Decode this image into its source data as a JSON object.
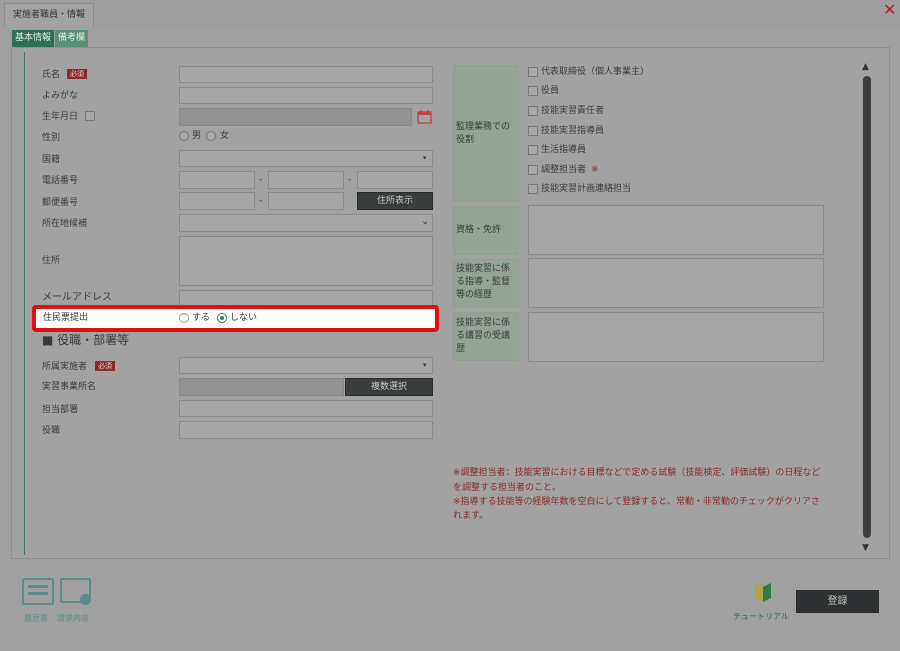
{
  "window": {
    "title": "実施者職員・情報",
    "close_glyph": "✕"
  },
  "tabs": [
    "基本情報",
    "備考欄"
  ],
  "form": {
    "name": {
      "label": "氏名",
      "required_badge": "必須"
    },
    "furigana": {
      "label": "よみがな"
    },
    "birthdate": {
      "label": "生年月日"
    },
    "gender": {
      "label": "性別",
      "options": [
        "男",
        "女"
      ]
    },
    "nationality": {
      "label": "国籍"
    },
    "phone": {
      "label": "電話番号",
      "sep1": "-",
      "sep2": "-"
    },
    "postal": {
      "label": "郵便番号",
      "sep": "-",
      "button": "住所表示"
    },
    "prefecture": {
      "label": "所在地候補"
    },
    "address": {
      "label": "住所"
    },
    "email": {
      "label": "メールアドレス"
    },
    "resident": {
      "label": "住民票提出",
      "options": [
        "する",
        "しない"
      ],
      "selected": "しない"
    },
    "section_heading": "■ 役職・部署等",
    "company": {
      "label": "所属実施者",
      "required_badge": "必須"
    },
    "site": {
      "label": "実習事業所名",
      "button": "複数選択"
    },
    "department": {
      "label": "担当部署"
    },
    "position": {
      "label": "役職"
    }
  },
  "right": {
    "roles_label": "監理業務での役割",
    "roles": [
      "代表取締役（個人事業主）",
      "役員",
      "技能実習責任者",
      "技能実習指導員",
      "生活指導員",
      "調整担当者",
      "技能実習計画連絡担当"
    ],
    "coordinator_mark": "※",
    "qualification_label": "資格・免許",
    "guidance_label": "技能実習に係る指導・監督等の経歴",
    "training_label": "技能実習に係る講習の受講歴"
  },
  "notes": [
    "※調整担当者：技能実習における目標などで定める試験（技能検定、評価試験）の日程など",
    "を調整する担当者のこと。",
    "※指導する技能等の経験年数を空白にして登録すると、常勤・非常勤のチェックがクリアさ",
    "れます。"
  ],
  "footer": {
    "resume_label": "履歴書",
    "request_label": "請求内容",
    "tutorial_label": "チュートリアル",
    "register_button": "登録"
  },
  "icons": [
    "calendar-icon",
    "chevron-down-icon",
    "scroll-up-icon",
    "scroll-down-icon",
    "beginner-leaf-icon"
  ],
  "colors": {
    "required": "#8c2a2a",
    "accent": "#2e7d6b",
    "highlight_border": "#e01010",
    "note_text": "#8a2a2a"
  }
}
